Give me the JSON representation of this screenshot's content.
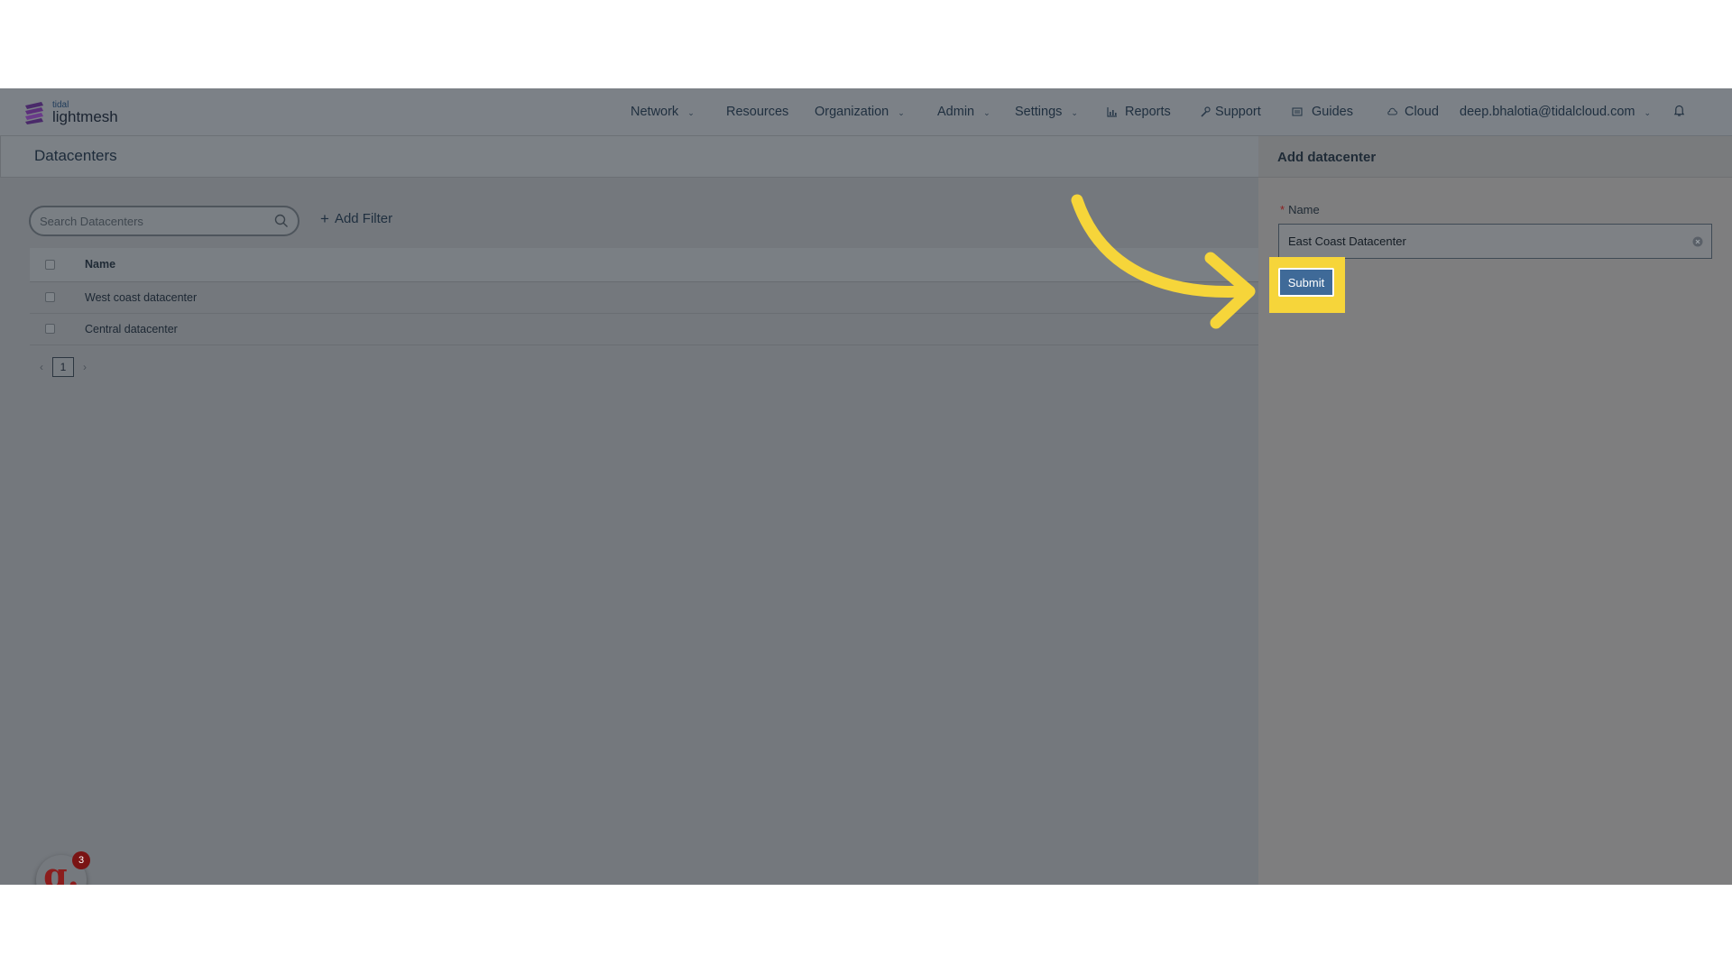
{
  "brand": {
    "small": "tidal",
    "name": "lightmesh"
  },
  "nav": {
    "network": "Network",
    "resources": "Resources",
    "organization": "Organization",
    "admin": "Admin",
    "settings": "Settings",
    "reports": "Reports",
    "support": "Support",
    "guides": "Guides",
    "cloud": "Cloud",
    "user": "deep.bhalotia@tidalcloud.com"
  },
  "page": {
    "title": "Datacenters"
  },
  "search": {
    "placeholder": "Search Datacenters"
  },
  "filter": {
    "label": "Add Filter"
  },
  "table": {
    "header": "Name",
    "rows": [
      "West coast datacenter",
      "Central datacenter"
    ]
  },
  "pagination": {
    "current": "1"
  },
  "guide_badge": {
    "letter": "g.",
    "count": "3"
  },
  "drawer": {
    "title": "Add datacenter",
    "required_mark": "*",
    "name_label": "Name",
    "name_value": "East Coast Datacenter",
    "submit_label": "Submit"
  },
  "colors": {
    "highlight": "#f6d53a",
    "arrow": "#f6d53a",
    "primary_button": "#3f6a98"
  },
  "icons": [
    "search-icon",
    "chevron-down-icon",
    "bar-chart-icon",
    "wrench-icon",
    "book-icon",
    "cloud-icon",
    "bell-icon",
    "clear-icon",
    "arrow-annotation-icon"
  ]
}
